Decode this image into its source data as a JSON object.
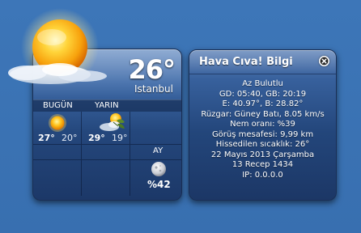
{
  "weather": {
    "current_temp": "26°",
    "city": "Istanbul",
    "today_label": "BUGÜN",
    "tomorrow_label": "YARIN",
    "today_high": "27°",
    "today_low": "20°",
    "tomorrow_high": "29°",
    "tomorrow_low": "19°",
    "today_icon": "sun-icon",
    "tomorrow_icon": "partly-cloudy-icon",
    "current_icon": "sun-cloud-icon",
    "moon_label": "AY",
    "moon_icon": "moon-icon",
    "moon_percent": "%42"
  },
  "info": {
    "title": "Hava Cıva! Bilgi",
    "lines": [
      "Az Bulutlu",
      "GD: 05:40, GB: 20:19",
      "E: 40.97°, B: 28.82°",
      "Rüzgar: Güney Batı, 8.05 km/s",
      "Nem oranı: %39",
      "Görüş mesafesi: 9,99 km",
      "Hissedilen sıcaklık: 26°",
      "22 Mayıs 2013 Çarşamba",
      "13 Recep 1434",
      "IP: 0.0.0.0"
    ]
  },
  "colors": {
    "desktop": "#3a72b4",
    "panel_dark": "#1c3766",
    "panel_light": "#5b80b6",
    "text": "#ffffff"
  }
}
